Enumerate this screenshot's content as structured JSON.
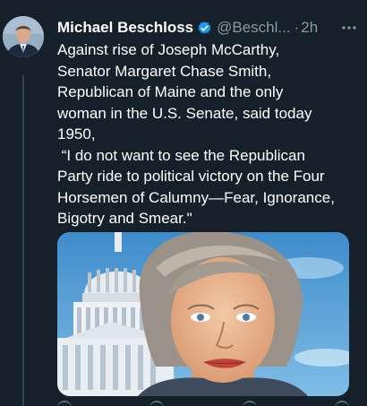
{
  "tweet": {
    "author_name": "Michael Beschloss",
    "handle": "@Beschl...",
    "separator": "·",
    "time": "2h",
    "more_icon": "more-horizontal-icon",
    "verified_icon": "verified-badge-icon",
    "text_lines": [
      "Against rise of Joseph McCarthy,",
      "Senator Margaret Chase Smith,",
      "Republican of Maine and the only",
      "woman in the U.S. Senate, said today",
      "1950,",
      " “I do not want to see the Republican",
      "Party ride to political victory on the Four",
      "Horsemen of Calumny—Fear, Ignorance,",
      "Bigotry and Smear.\""
    ]
  },
  "colors": {
    "background": "#15202b",
    "text": "#ffffff",
    "secondary": "#8b98a5",
    "verified": "#1d9bf0"
  }
}
